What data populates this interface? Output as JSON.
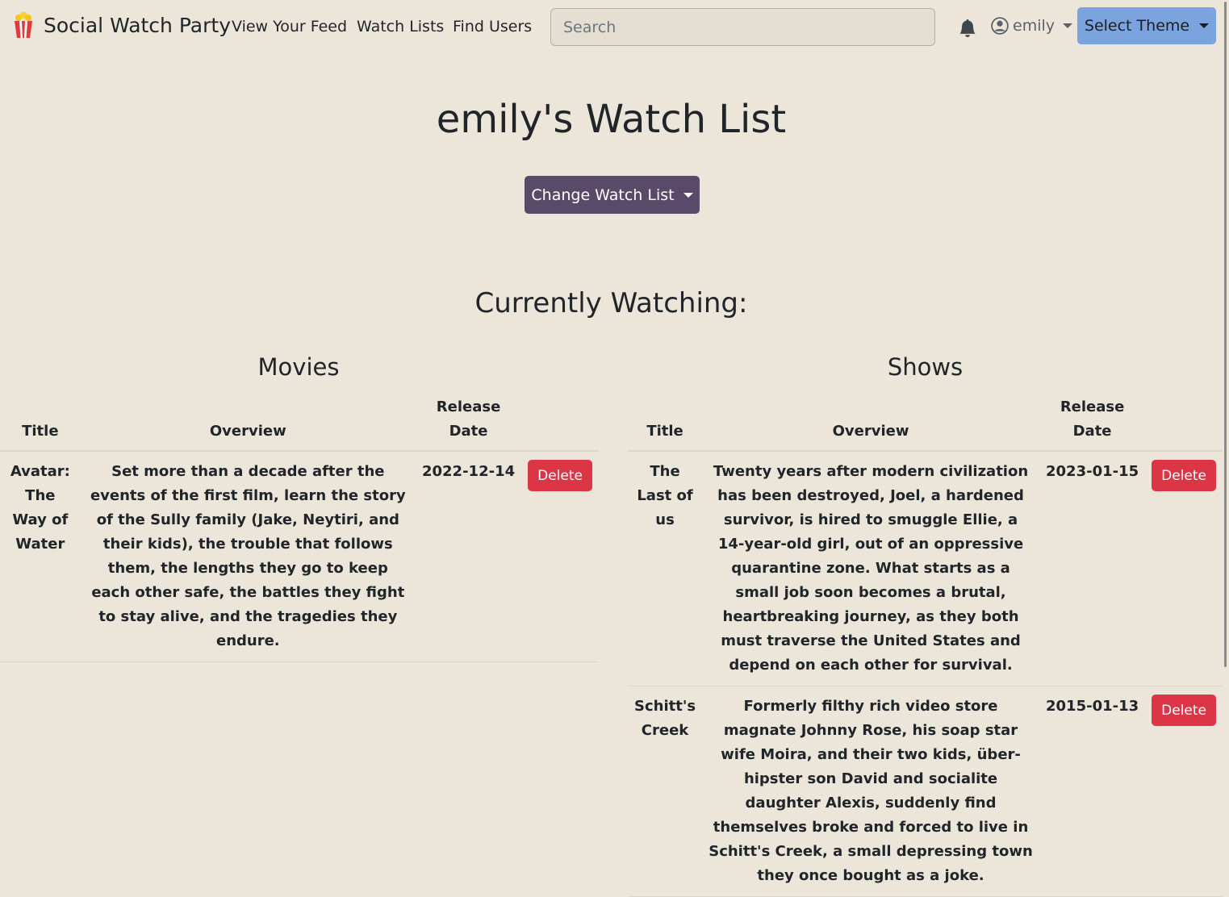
{
  "navbar": {
    "brand": "Social Watch Party",
    "links": [
      "View Your Feed",
      "Watch Lists",
      "Find Users"
    ],
    "search_placeholder": "Search",
    "user": "emily",
    "theme_button": "Select Theme"
  },
  "page": {
    "title": "emily's Watch List",
    "change_button": "Change Watch List",
    "section_title": "Currently Watching:"
  },
  "movies": {
    "title": "Movies",
    "headers": [
      "Title",
      "Overview",
      "Release Date"
    ],
    "rows": [
      {
        "title": "Avatar: The Way of Water",
        "overview": "Set more than a decade after the events of the first film, learn the story of the Sully family (Jake, Neytiri, and their kids), the trouble that follows them, the lengths they go to keep each other safe, the battles they fight to stay alive, and the tragedies they endure.",
        "date": "2022-12-14",
        "action": "Delete"
      }
    ]
  },
  "shows": {
    "title": "Shows",
    "headers": [
      "Title",
      "Overview",
      "Release Date"
    ],
    "rows": [
      {
        "title": "The Last of us",
        "overview": "Twenty years after modern civilization has been destroyed, Joel, a hardened survivor, is hired to smuggle Ellie, a 14-year-old girl, out of an oppressive quarantine zone. What starts as a small job soon becomes a brutal, heartbreaking journey, as they both must traverse the United States and depend on each other for survival.",
        "date": "2023-01-15",
        "action": "Delete"
      },
      {
        "title": "Schitt's Creek",
        "overview": "Formerly filthy rich video store magnate Johnny Rose, his soap star wife Moira, and their two kids, über-hipster son David and socialite daughter Alexis, suddenly find themselves broke and forced to live in Schitt's Creek, a small depressing town they once bought as a joke.",
        "date": "2015-01-13",
        "action": "Delete"
      }
    ]
  },
  "colors": {
    "background": "#ece6da",
    "theme_button": "#7ba4df",
    "change_button": "#594a6a",
    "delete_button": "#dc3545"
  }
}
